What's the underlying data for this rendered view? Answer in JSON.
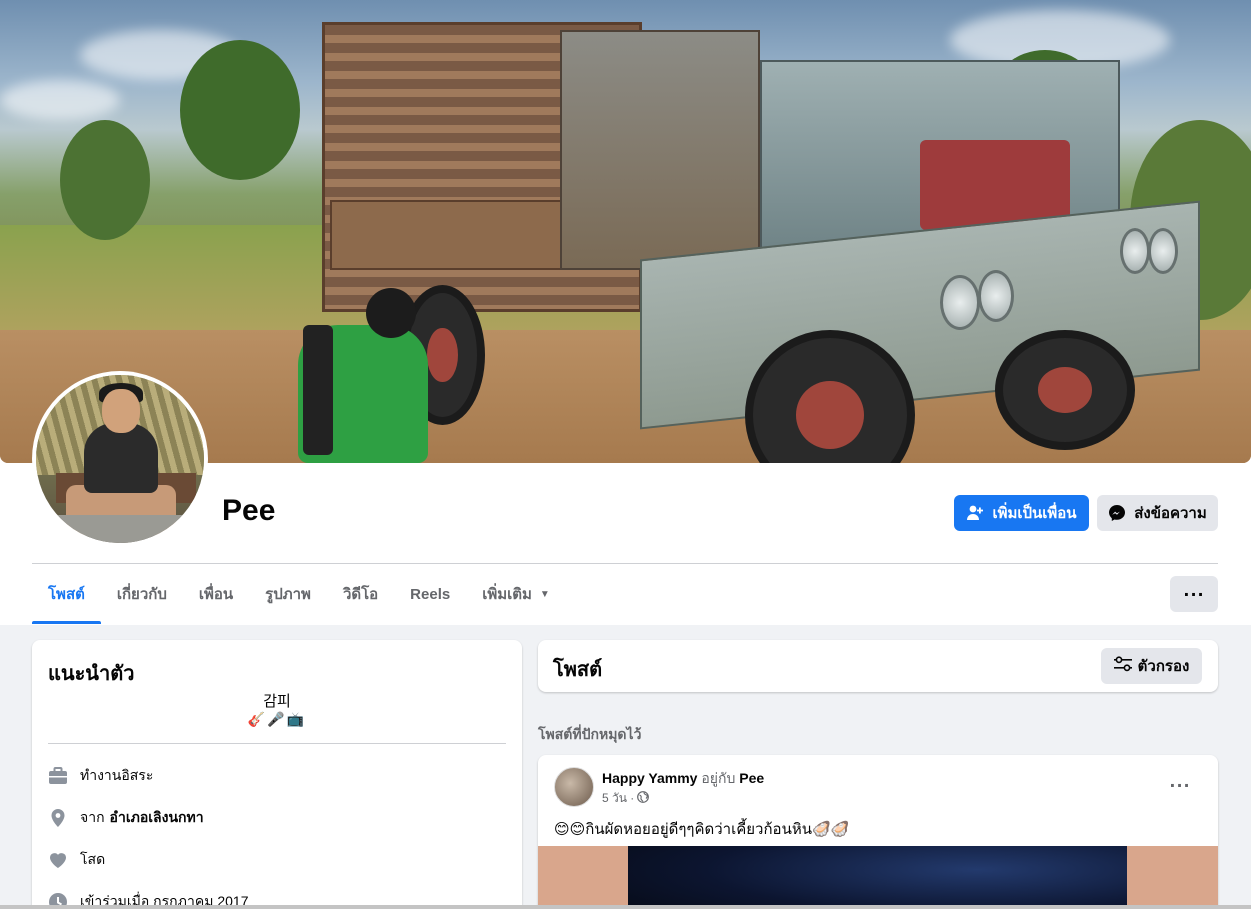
{
  "profile": {
    "name": "Pee"
  },
  "actions": {
    "add_friend_label": "เพิ่มเป็นเพื่อน",
    "message_label": "ส่งข้อความ",
    "more_label": "···"
  },
  "tabs": [
    {
      "label": "โพสต์",
      "active": true
    },
    {
      "label": "เกี่ยวกับ",
      "active": false
    },
    {
      "label": "เพื่อน",
      "active": false
    },
    {
      "label": "รูปภาพ",
      "active": false
    },
    {
      "label": "วิดีโอ",
      "active": false
    },
    {
      "label": "Reels",
      "active": false
    },
    {
      "label": "เพิ่มเติม",
      "active": false,
      "dropdown": true
    }
  ],
  "intro": {
    "title": "แนะนำตัว",
    "bio": "감피",
    "bio_emoji": "🎸🎤📺",
    "rows": [
      {
        "icon": "briefcase-icon",
        "text": "ทำงานอิสระ",
        "bold": ""
      },
      {
        "icon": "location-pin-icon",
        "text": "จาก",
        "bold": "อำเภอเลิงนกทา"
      },
      {
        "icon": "heart-icon",
        "text": "โสด",
        "bold": ""
      },
      {
        "icon": "clock-icon",
        "text": "เข้าร่วมเมื่อ กรกฎาคม 2017",
        "bold": ""
      }
    ]
  },
  "posts": {
    "title": "โพสต์",
    "filter_label": "ตัวกรอง",
    "pinned_label": "โพสต์ที่ปักหมุดไว้",
    "pinned_post": {
      "author": "Happy Yammy",
      "with_text": "อยู่กับ",
      "tagged": "Pee",
      "time": "5 วัน ·",
      "privacy_icon": "globe-icon",
      "text": "😊😊กินผัดหอยอยู่ดีๆๆคิดว่าเคี้ยวก้อนหิน🦪🦪"
    }
  },
  "colors": {
    "accent": "#1877f2",
    "page_bg": "#f0f2f5",
    "secondary_button": "#e4e6eb",
    "muted_text": "#65676b"
  }
}
